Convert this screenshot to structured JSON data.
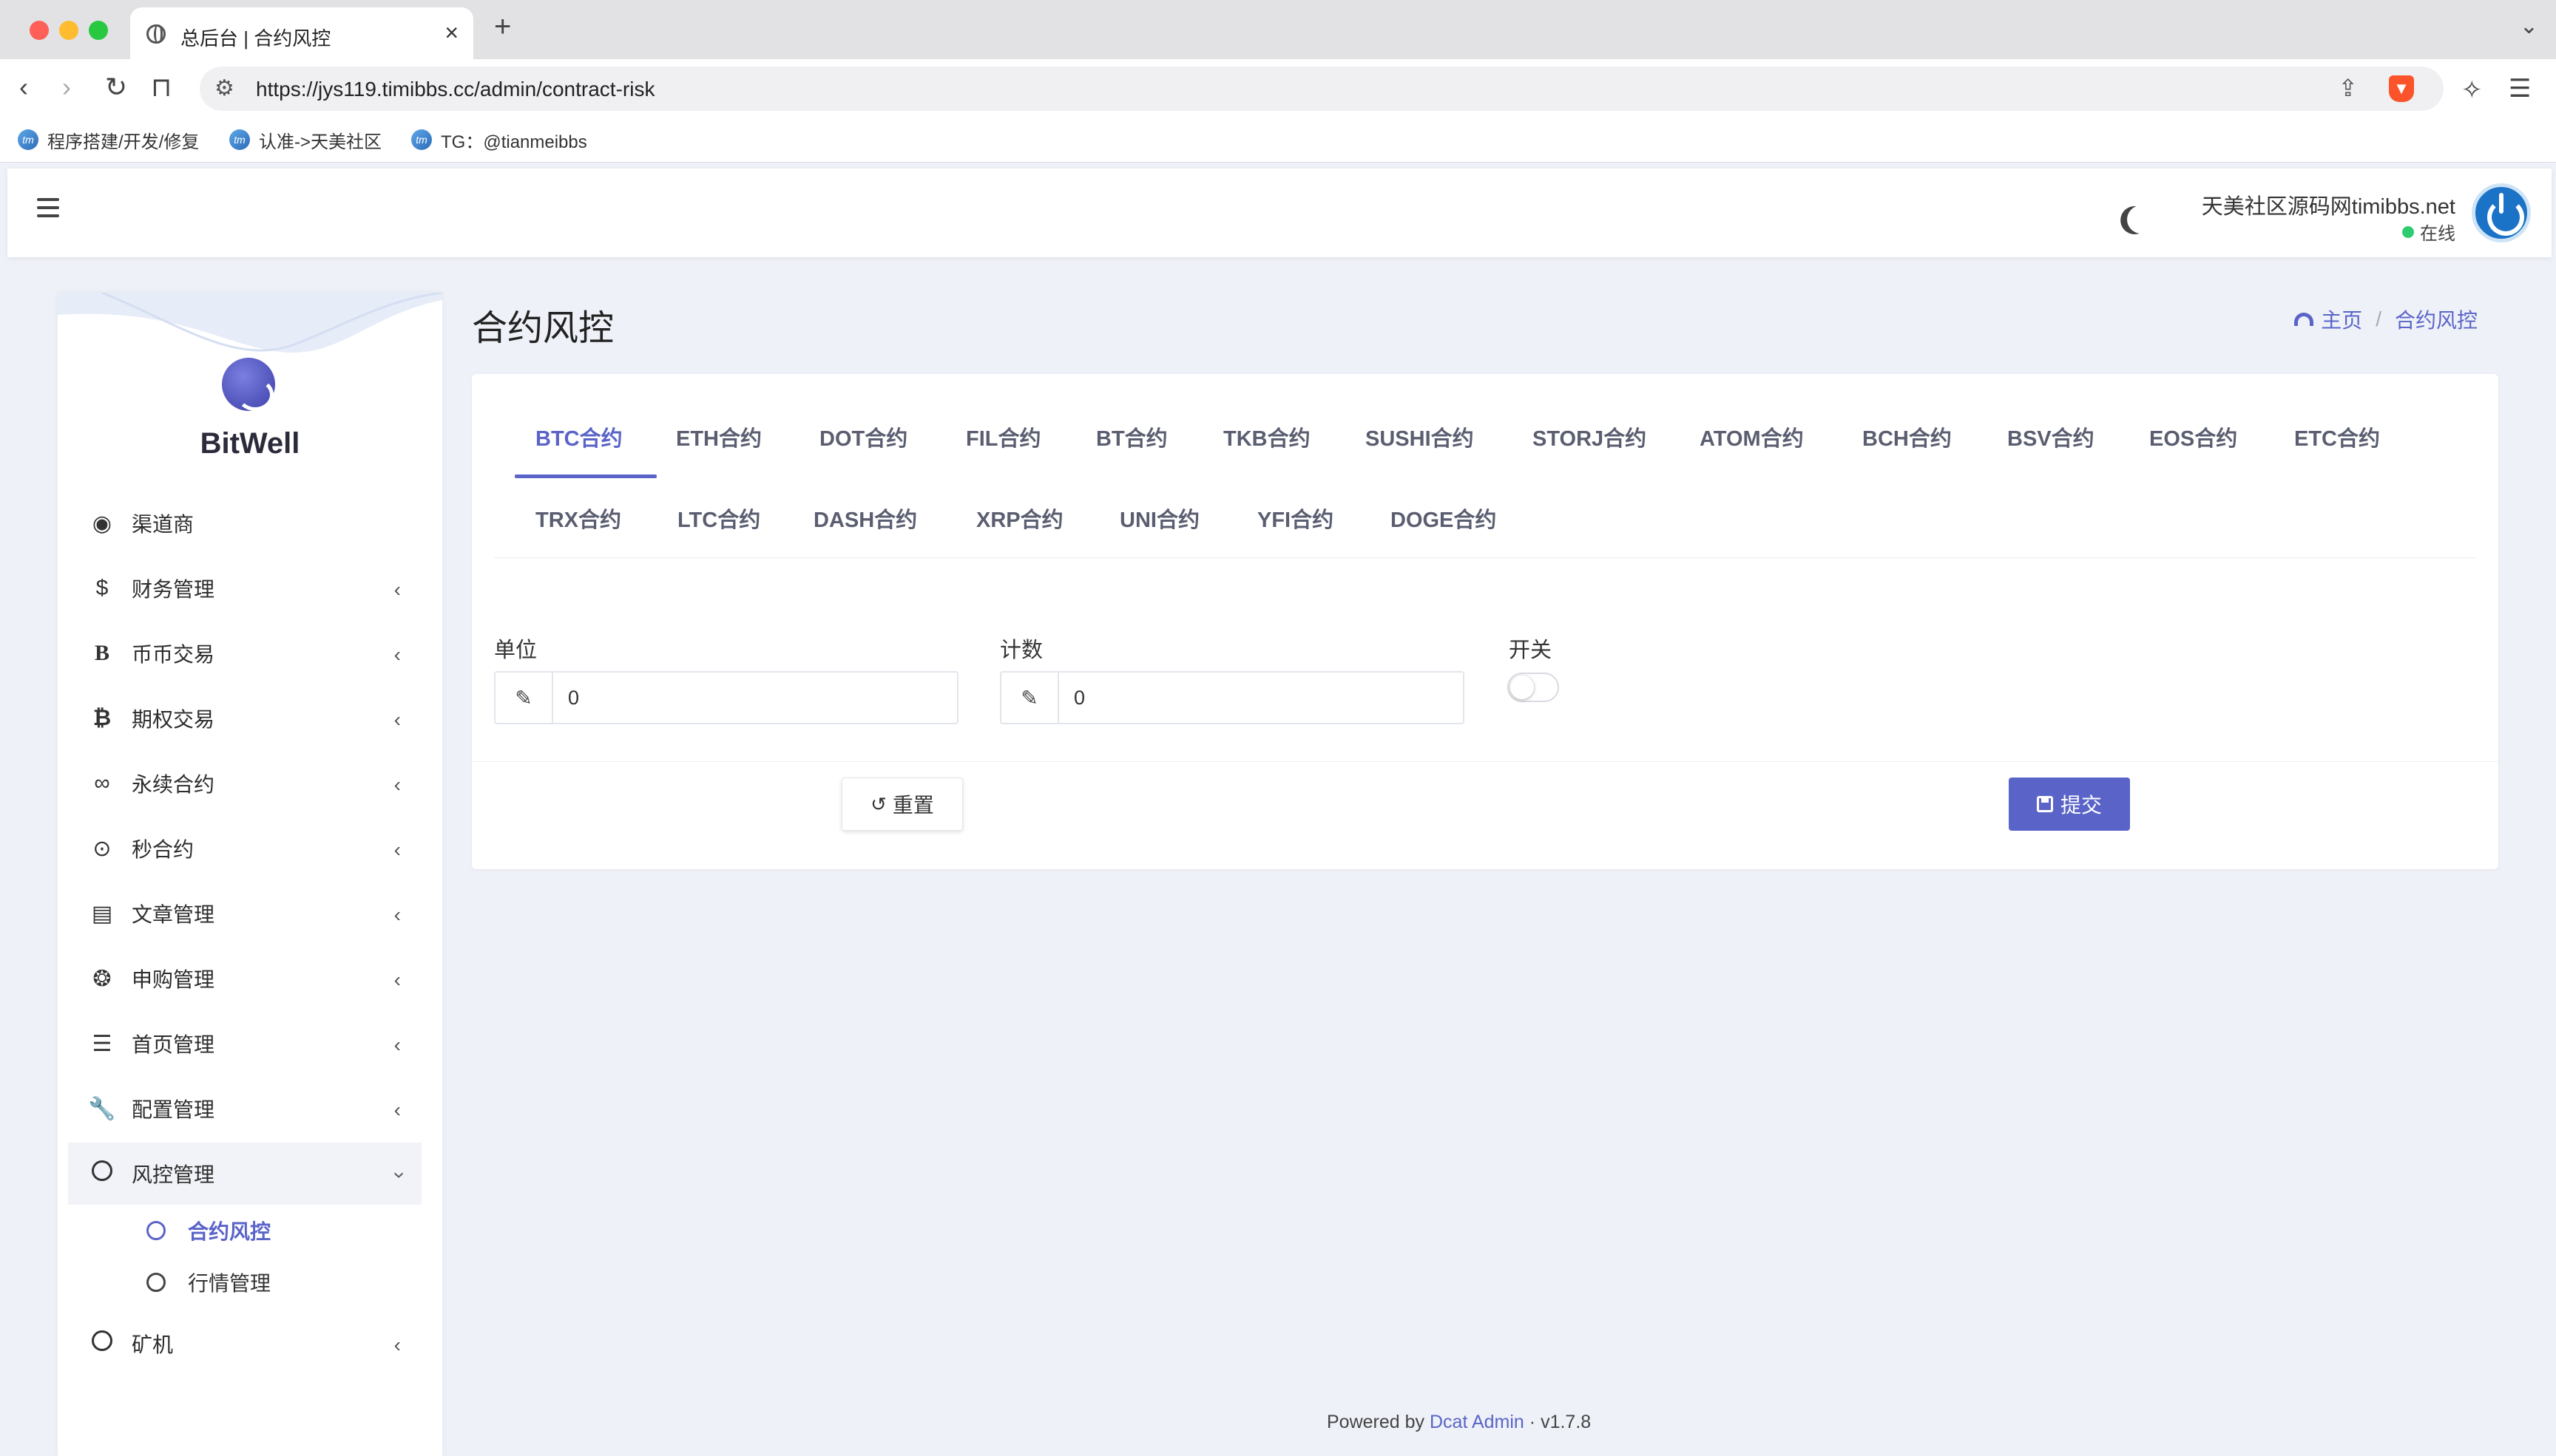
{
  "browser": {
    "tab_title": "总后台 | 合约风控",
    "url": "https://jys119.timibbs.cc/admin/contract-risk",
    "bookmarks": [
      "程序搭建/开发/修复",
      "认准->天美社区",
      "TG：@tianmeibbs"
    ]
  },
  "header": {
    "user_name": "天美社区源码网timibbs.net",
    "status": "在线"
  },
  "sidebar": {
    "logo": "BitWell",
    "items": [
      {
        "label": "渠道商",
        "icon": "user-circle-icon"
      },
      {
        "label": "财务管理",
        "icon": "dollar-icon"
      },
      {
        "label": "币币交易",
        "icon": "bold-b-icon"
      },
      {
        "label": "期权交易",
        "icon": "bitcoin-icon"
      },
      {
        "label": "永续合约",
        "icon": "link-icon"
      },
      {
        "label": "秒合约",
        "icon": "dot-circle-icon"
      },
      {
        "label": "文章管理",
        "icon": "newspaper-icon"
      },
      {
        "label": "申购管理",
        "icon": "lifebuoy-icon"
      },
      {
        "label": "首页管理",
        "icon": "list-icon"
      },
      {
        "label": "配置管理",
        "icon": "wrench-icon"
      },
      {
        "label": "风控管理",
        "icon": "circle-icon"
      }
    ],
    "sub_items": [
      "合约风控",
      "行情管理"
    ],
    "last_item": {
      "label": "矿机",
      "icon": "circle-icon"
    }
  },
  "page": {
    "title": "合约风控",
    "breadcrumb": [
      "主页",
      "合约风控"
    ]
  },
  "tabs": {
    "row1": [
      "BTC合约",
      "ETH合约",
      "DOT合约",
      "FIL合约",
      "BT合约",
      "TKB合约",
      "SUSHI合约",
      "STORJ合约",
      "ATOM合约",
      "BCH合约",
      "BSV合约",
      "EOS合约",
      "ETC合约"
    ],
    "row2": [
      "TRX合约",
      "LTC合约",
      "DASH合约",
      "XRP合约",
      "UNI合约",
      "YFI合约",
      "DOGE合约"
    ],
    "active": "BTC合约"
  },
  "form": {
    "unit_label": "单位",
    "unit_value": "0",
    "count_label": "计数",
    "count_value": "0",
    "switch_label": "开关",
    "switch_on": false,
    "reset_label": "重置",
    "submit_label": "提交"
  },
  "footer": {
    "prefix": "Powered by",
    "link": "Dcat Admin",
    "separator": "·",
    "version": "v1.7.8"
  },
  "colors": {
    "accent": "#5a64c8",
    "background": "#eef1f7"
  }
}
